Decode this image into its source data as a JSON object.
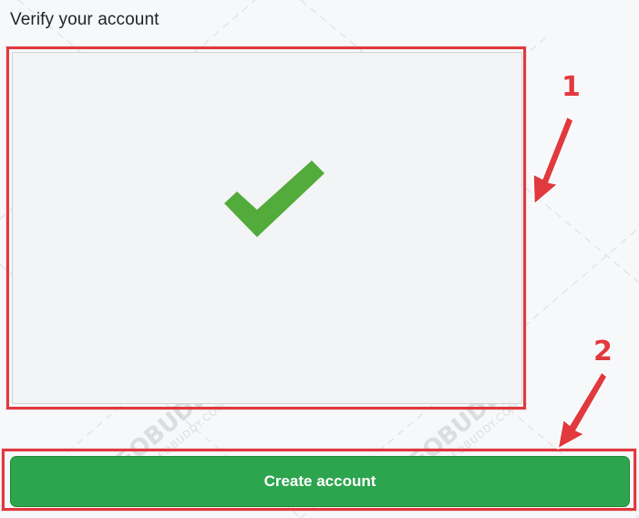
{
  "heading": "Verify your account",
  "verification": {
    "status_icon": "checkmark-icon",
    "check_color": "#52ab3a"
  },
  "button": {
    "label": "Create account",
    "color": "#2da44e"
  },
  "annotations": {
    "first": "1",
    "second": "2",
    "color": "#e0393e"
  },
  "watermark": {
    "brand": "SEOBUDDY",
    "site": "WWW.SEOBUDDY.COM"
  }
}
